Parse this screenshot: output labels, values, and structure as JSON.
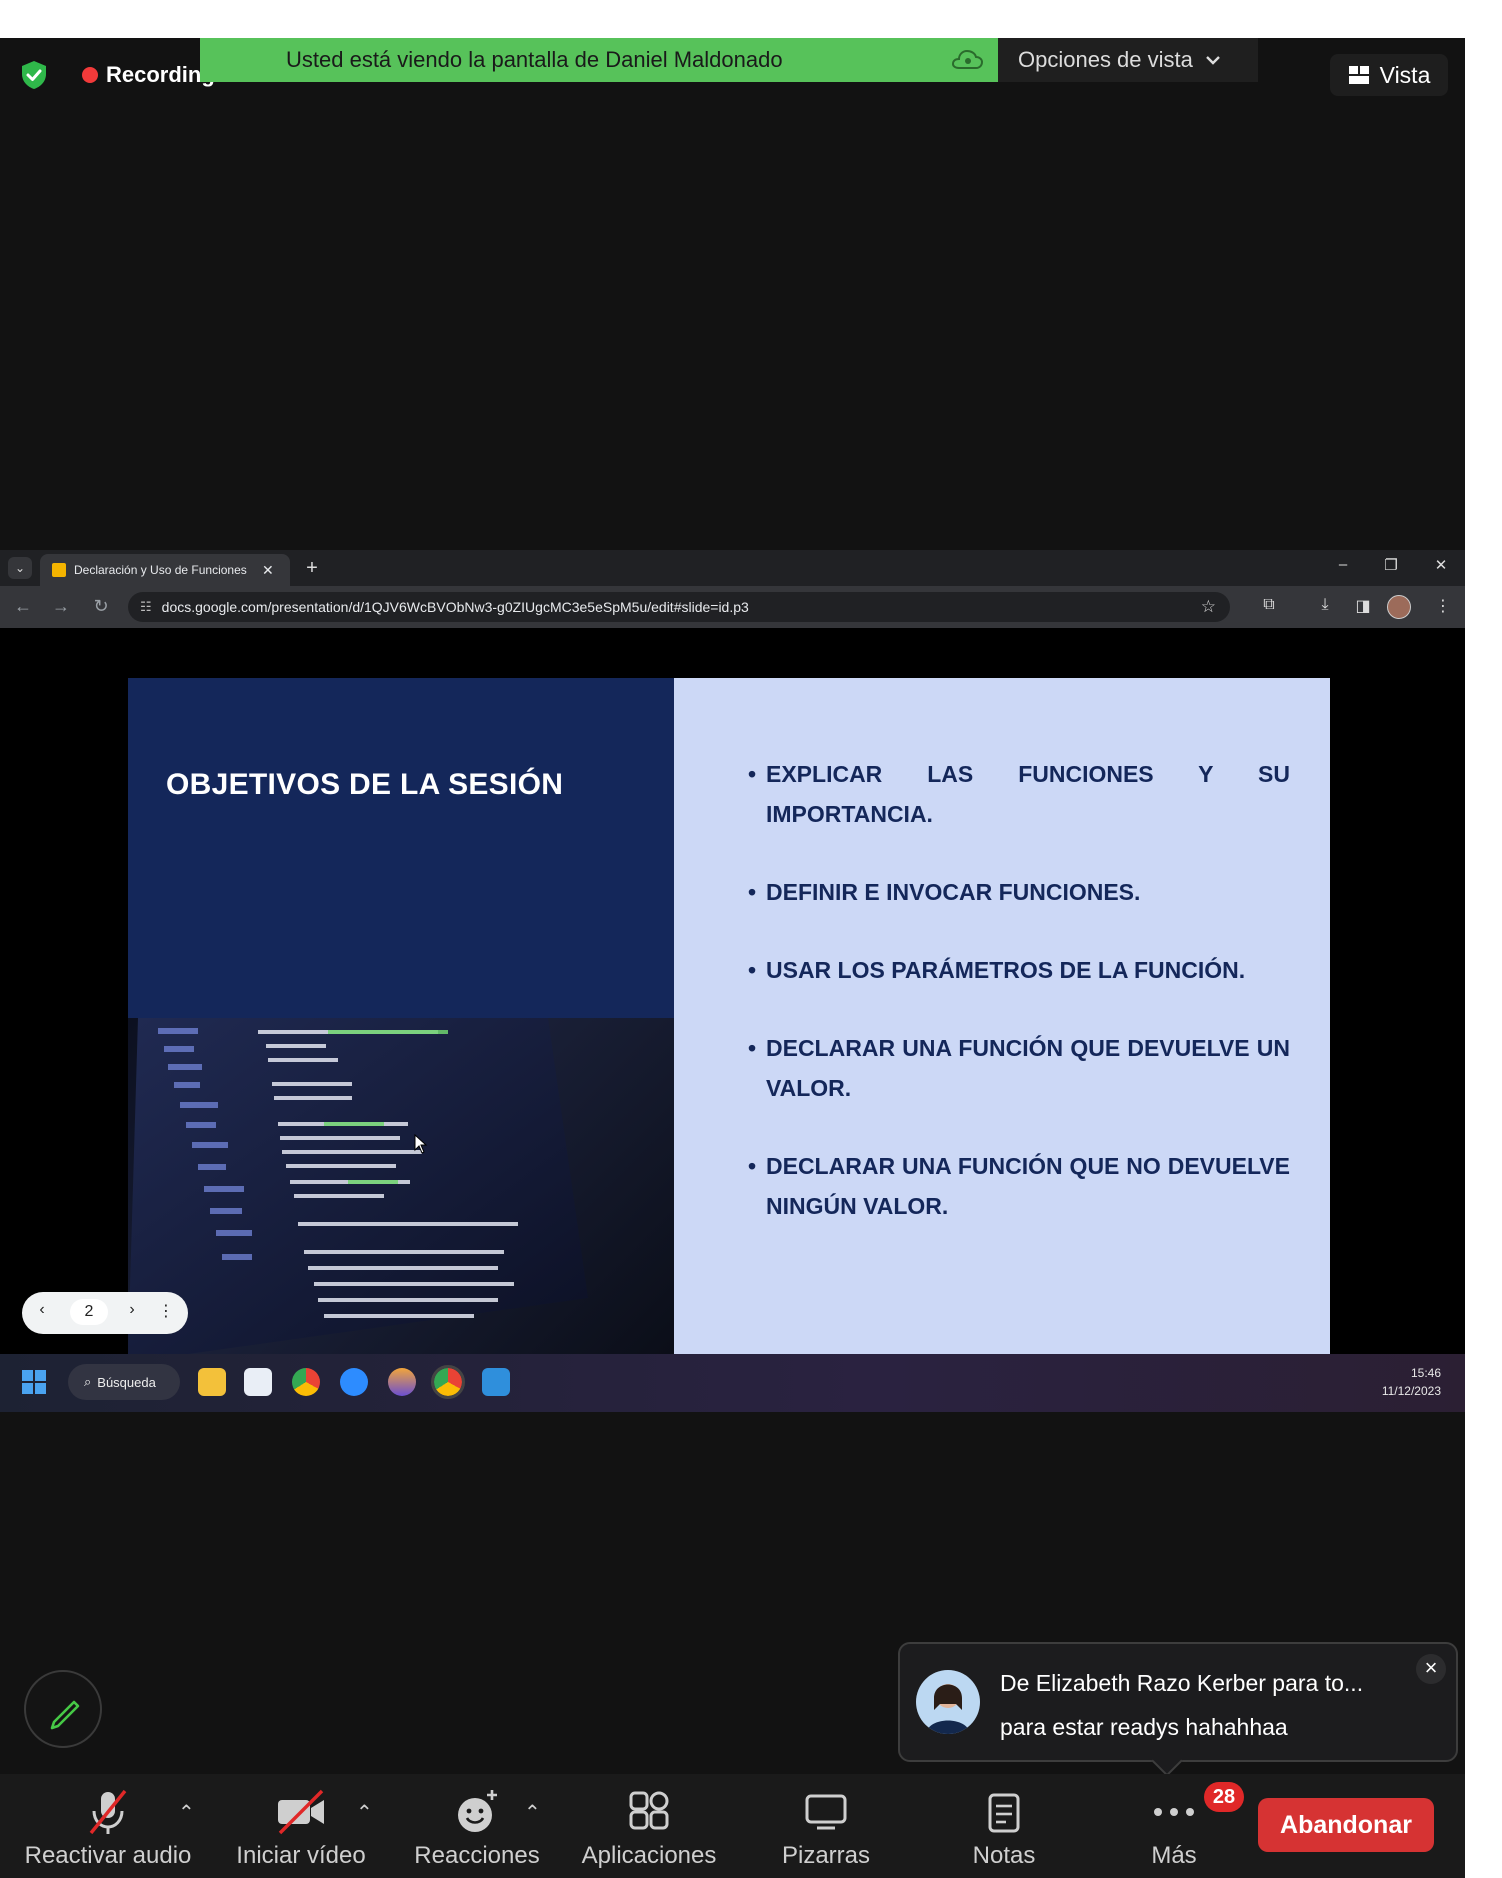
{
  "topbar": {
    "recording_label": "Recording",
    "share_banner": "Usted está viendo la pantalla de Daniel Maldonado",
    "view_options": "Opciones de vista",
    "view_button": "Vista"
  },
  "browser": {
    "tab_title": "Declaración y Uso de Funciones",
    "url": "docs.google.com/presentation/d/1QJV6WcBVObNw3-g0ZIUgcMC3e5eSpM5u/edit#slide=id.p3"
  },
  "slide": {
    "title": "OBJETIVOS DE LA SESIÓN",
    "bullets": [
      "EXPLICAR LAS FUNCIONES Y SU IMPORTANCIA.",
      "DEFINIR E INVOCAR FUNCIONES.",
      "USAR LOS PARÁMETROS DE LA FUNCIÓN.",
      "DECLARAR UNA FUNCIÓN QUE DEVUELVE UN VALOR.",
      "DECLARAR UNA FUNCIÓN QUE NO DEVUELVE NINGÚN VALOR."
    ],
    "current_page": "2"
  },
  "taskbar": {
    "search_label": "Búsqueda",
    "time": "15:46",
    "date": "11/12/2023"
  },
  "chat_toast": {
    "title": "De Elizabeth Razo Kerber para to...",
    "message": "para estar readys hahahhaa"
  },
  "toolbar": {
    "audio": "Reactivar audio",
    "video": "Iniciar vídeo",
    "reactions": "Reacciones",
    "apps": "Aplicaciones",
    "whiteboards": "Pizarras",
    "notes": "Notas",
    "more": "Más",
    "more_badge": "28",
    "leave": "Abandonar"
  },
  "colors": {
    "share_banner_bg": "#57c25a",
    "slide_dark_blue": "#14275a",
    "slide_light_blue": "#ccd8f6",
    "leave_red": "#d63333",
    "recording_red": "#f23a3a"
  },
  "icons": [
    "shield-check-icon",
    "recording-dot-icon",
    "cloud-icon",
    "chevron-down-icon",
    "grid-icon",
    "mic-off-icon",
    "video-off-icon",
    "reaction-icon",
    "apps-icon",
    "whiteboard-icon",
    "notes-icon",
    "more-dots-icon",
    "pencil-icon",
    "close-icon"
  ]
}
